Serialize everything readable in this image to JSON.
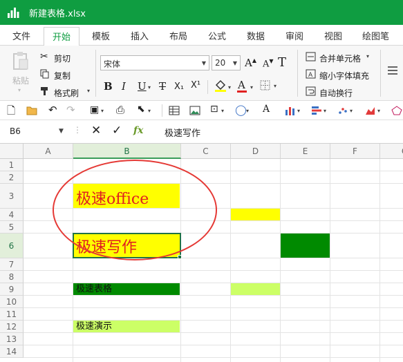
{
  "window": {
    "title": "新建表格.xlsx"
  },
  "menu": [
    "文件",
    "开始",
    "模板",
    "插入",
    "布局",
    "公式",
    "数据",
    "审阅",
    "视图",
    "绘图笔"
  ],
  "ribbon": {
    "paste": "粘贴",
    "cut": "剪切",
    "copy": "复制",
    "format_painter": "格式刷",
    "font_name": "宋体",
    "font_size": "20",
    "merge": "合并单元格",
    "shrink": "缩小字体填充",
    "wrap": "自动换行",
    "bold": "B",
    "italic": "I",
    "underline": "U",
    "strike": "T",
    "subscript": "X₁",
    "superscript": "X¹",
    "font_color_letter": "A"
  },
  "formula": {
    "cell_ref": "B6",
    "fx": "fx",
    "content": "极速写作"
  },
  "columns": [
    "A",
    "B",
    "C",
    "D",
    "E",
    "F",
    "G"
  ],
  "rows": [
    "1",
    "2",
    "3",
    "4",
    "5",
    "6",
    "7",
    "8",
    "9",
    "10",
    "11",
    "12",
    "13",
    "14"
  ],
  "cells": {
    "b3": "极速office",
    "b6": "极速写作",
    "b9": "极速表格",
    "b12": "极速演示"
  },
  "colors": {
    "brand": "#0f9d41",
    "yellow": "#ffff00",
    "dark_green": "#008a00",
    "light_green": "#ccff66",
    "red_text": "#e02020",
    "annotation": "#e53935"
  }
}
